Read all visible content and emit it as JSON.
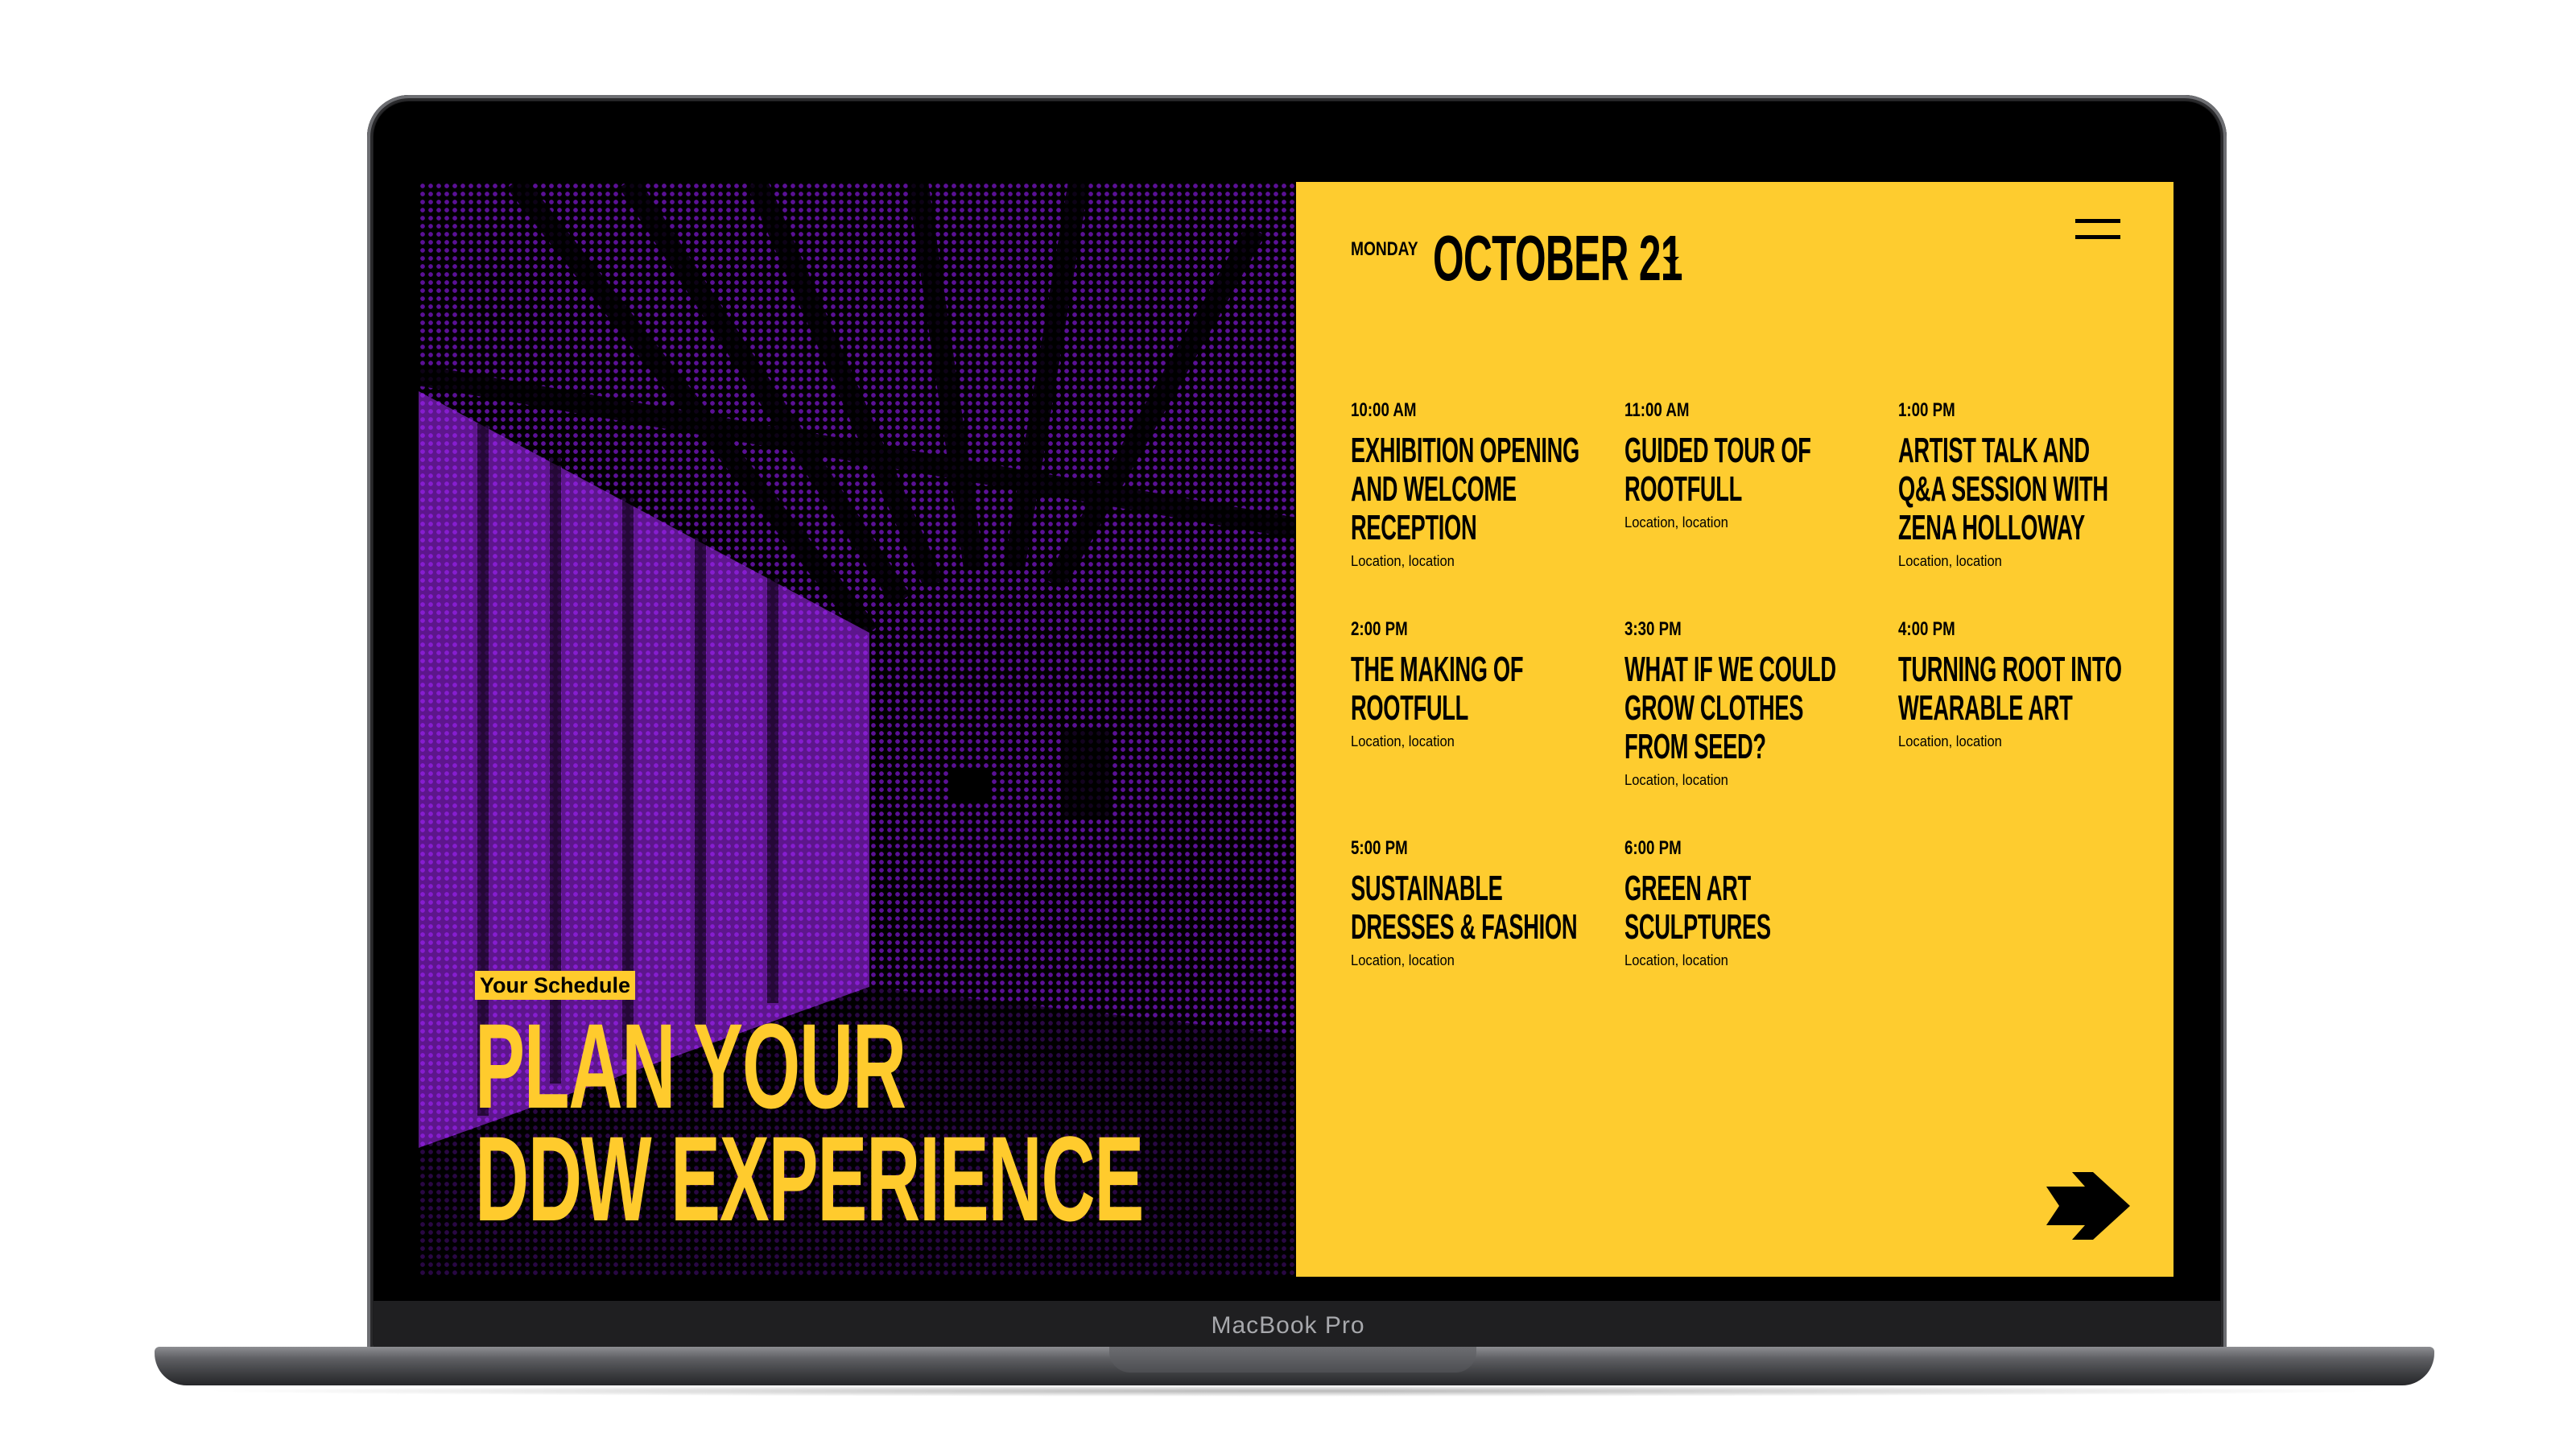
{
  "device": {
    "label": "MacBook Pro"
  },
  "colors": {
    "accent": "#fecc2f",
    "halftone": "#8c1ae6",
    "background": "#000000"
  },
  "hero": {
    "tag": "Your Schedule",
    "headline_line1": "PLAN YOUR",
    "headline_line2": "DDW EXPERIENCE"
  },
  "schedule": {
    "day": "MONDAY",
    "date": "OCTOBER 21",
    "events": [
      {
        "time": "10:00 AM",
        "title": "Exhibition Opening and Welcome Reception",
        "location": "Location, location"
      },
      {
        "time": "11:00 AM",
        "title": "Guided Tour of Rootfull",
        "location": "Location, location"
      },
      {
        "time": "1:00 PM",
        "title": "Artist Talk and Q&A Session with Zena Holloway",
        "location": "Location, location"
      },
      {
        "time": "2:00 PM",
        "title": "The Making of Rootfull",
        "location": "Location, location"
      },
      {
        "time": "3:30 PM",
        "title": "What if we could grow clothes from seed?",
        "location": "Location, location"
      },
      {
        "time": "4:00 PM",
        "title": "Turning Root into Wearable Art",
        "location": "Location, location"
      },
      {
        "time": "5:00 PM",
        "title": "Sustainable Dresses & Fashion",
        "location": "Location, location"
      },
      {
        "time": "6:00 PM",
        "title": "Green Art Sculptures",
        "location": "Location, location"
      }
    ]
  },
  "icons": {
    "menu": "hamburger-menu-icon",
    "dropdown": "chevron-down-icon",
    "next": "arrow-right-icon"
  }
}
